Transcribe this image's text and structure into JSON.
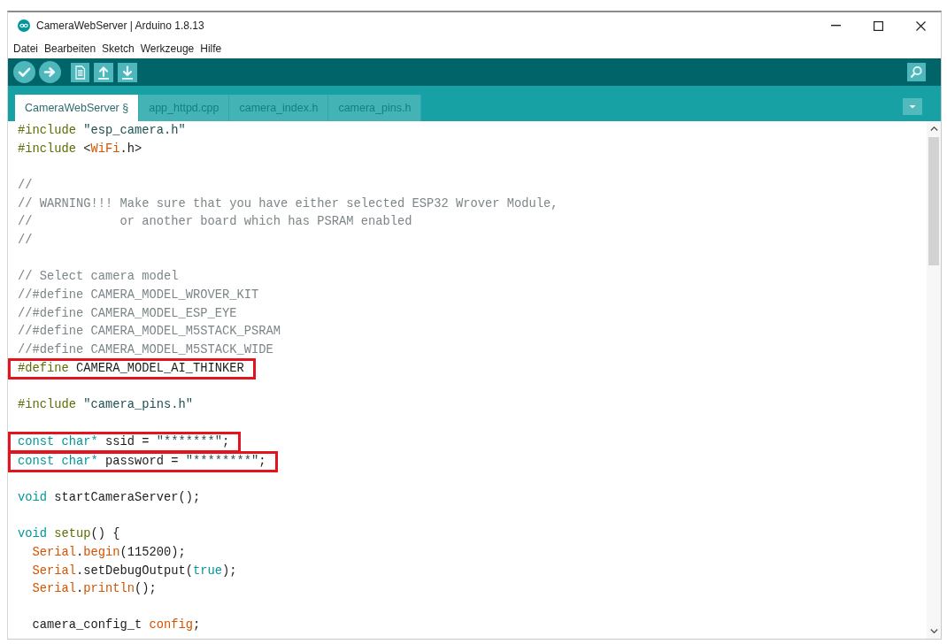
{
  "window": {
    "title": "CameraWebServer | Arduino 1.8.13"
  },
  "menu": [
    "Datei",
    "Bearbeiten",
    "Sketch",
    "Werkzeuge",
    "Hilfe"
  ],
  "tabs": [
    {
      "label": "CameraWebServer §",
      "selected": true
    },
    {
      "label": "app_httpd.cpp",
      "selected": false
    },
    {
      "label": "camera_index.h",
      "selected": false
    },
    {
      "label": "camera_pins.h",
      "selected": false
    }
  ],
  "editor": {
    "blocks": [
      {
        "lines": [
          {
            "segments": [
              {
                "text": "#include",
                "kind": "directive"
              },
              {
                "text": " \"esp_camera.h\"",
                "kind": "string"
              }
            ],
            "highlighted": false
          },
          {
            "segments": [
              {
                "text": "#include",
                "kind": "directive"
              },
              {
                "text": " <",
                "kind": "plain"
              },
              {
                "text": "WiFi",
                "kind": "function"
              },
              {
                "text": ".h>",
                "kind": "plain"
              }
            ],
            "highlighted": false
          }
        ]
      },
      {
        "lines": [
          {
            "segments": [
              {
                "text": "//",
                "kind": "comment"
              }
            ],
            "highlighted": false
          },
          {
            "segments": [
              {
                "text": "// WARNING!!! Make sure that you have either selected ESP32 Wrover Module,",
                "kind": "comment"
              }
            ],
            "highlighted": false
          },
          {
            "segments": [
              {
                "text": "//            or another board which has PSRAM enabled",
                "kind": "comment"
              }
            ],
            "highlighted": false
          },
          {
            "segments": [
              {
                "text": "//",
                "kind": "comment"
              }
            ],
            "highlighted": false
          }
        ]
      },
      {
        "lines": [
          {
            "segments": [
              {
                "text": "// Select camera model",
                "kind": "comment"
              }
            ],
            "highlighted": false
          },
          {
            "segments": [
              {
                "text": "//#define CAMERA_MODEL_WROVER_KIT",
                "kind": "comment"
              }
            ],
            "highlighted": false
          },
          {
            "segments": [
              {
                "text": "//#define CAMERA_MODEL_ESP_EYE",
                "kind": "comment"
              }
            ],
            "highlighted": false
          },
          {
            "segments": [
              {
                "text": "//#define CAMERA_MODEL_M5STACK_PSRAM",
                "kind": "comment"
              }
            ],
            "highlighted": false
          },
          {
            "segments": [
              {
                "text": "//#define CAMERA_MODEL_M5STACK_WIDE",
                "kind": "comment"
              }
            ],
            "highlighted": false
          },
          {
            "segments": [
              {
                "text": "#define",
                "kind": "directive"
              },
              {
                "text": " CAMERA_MODEL_AI_THINKER",
                "kind": "plain"
              }
            ],
            "highlighted": true
          }
        ]
      },
      {
        "lines": [
          {
            "segments": [
              {
                "text": "#include",
                "kind": "directive"
              },
              {
                "text": " \"camera_pins.h\"",
                "kind": "string"
              }
            ],
            "highlighted": false
          }
        ]
      },
      {
        "lines": [
          {
            "segments": [
              {
                "text": "const char*",
                "kind": "type"
              },
              {
                "text": " ssid = ",
                "kind": "plain"
              },
              {
                "text": "\"*******\"",
                "kind": "string"
              },
              {
                "text": ";",
                "kind": "plain"
              }
            ],
            "highlighted": true
          },
          {
            "segments": [
              {
                "text": "const char*",
                "kind": "type"
              },
              {
                "text": " password = ",
                "kind": "plain"
              },
              {
                "text": "\"********\"",
                "kind": "string"
              },
              {
                "text": ";",
                "kind": "plain"
              }
            ],
            "highlighted": true
          }
        ]
      },
      {
        "lines": [
          {
            "segments": [
              {
                "text": "void",
                "kind": "type"
              },
              {
                "text": " startCameraServer();",
                "kind": "plain"
              }
            ],
            "highlighted": false
          }
        ]
      },
      {
        "lines": [
          {
            "segments": [
              {
                "text": "void",
                "kind": "type"
              },
              {
                "text": " setup",
                "kind": "structure"
              },
              {
                "text": "() {",
                "kind": "plain"
              }
            ],
            "highlighted": false,
            "children": [
              {
                "lines": [
                  {
                    "segments": [
                      {
                        "text": "Serial",
                        "kind": "function"
                      },
                      {
                        "text": ".",
                        "kind": "plain"
                      },
                      {
                        "text": "begin",
                        "kind": "function"
                      },
                      {
                        "text": "(115200);",
                        "kind": "plain"
                      }
                    ],
                    "highlighted": false
                  },
                  {
                    "segments": [
                      {
                        "text": "Serial",
                        "kind": "function"
                      },
                      {
                        "text": ".setDebugOutput(",
                        "kind": "plain"
                      },
                      {
                        "text": "true",
                        "kind": "type"
                      },
                      {
                        "text": ");",
                        "kind": "plain"
                      }
                    ],
                    "highlighted": false
                  },
                  {
                    "segments": [
                      {
                        "text": "Serial",
                        "kind": "function"
                      },
                      {
                        "text": ".",
                        "kind": "plain"
                      },
                      {
                        "text": "println",
                        "kind": "function"
                      },
                      {
                        "text": "();",
                        "kind": "plain"
                      }
                    ],
                    "highlighted": false
                  }
                ]
              },
              {
                "lines": [
                  {
                    "segments": [
                      {
                        "text": "camera_config_t ",
                        "kind": "plain"
                      },
                      {
                        "text": "config",
                        "kind": "function"
                      },
                      {
                        "text": ";",
                        "kind": "plain"
                      }
                    ],
                    "highlighted": false
                  }
                ]
              }
            ]
          }
        ]
      }
    ]
  }
}
